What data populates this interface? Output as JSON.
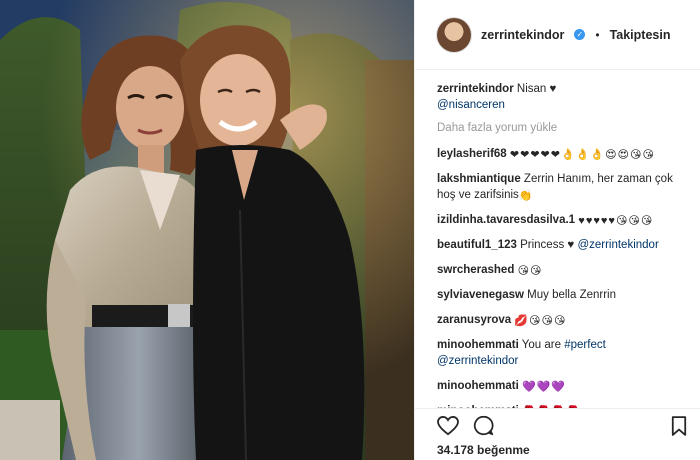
{
  "header": {
    "username": "zerrintekindor",
    "separator": "•",
    "follow_label": "Takiptesin"
  },
  "caption": {
    "user": "zerrintekindor",
    "text": "Nisan ♥",
    "mention": "@nisanceren"
  },
  "load_more": "Daha fazla yorum yükle",
  "comments": [
    {
      "user": "leylasherif68",
      "text": "",
      "emoji": "❤❤❤❤❤👌👌👌😍😍😘😘"
    },
    {
      "user": "lakshmiantique",
      "text": "Zerrin Hanım, her zaman çok hoş ve zarifsinis",
      "emoji": "👏"
    },
    {
      "user": "izildinha.tavaresdasilva.1",
      "text": "",
      "emoji": "♥♥♥♥♥😘😘😘"
    },
    {
      "user": "beautiful1_123",
      "text": "Princess ♥",
      "mention": "@zerrintekindor",
      "emoji": ""
    },
    {
      "user": "swrcherashed",
      "text": "",
      "emoji": "😘😘"
    },
    {
      "user": "sylviavenegasw",
      "text": "Muy bella Zenrrin",
      "emoji": ""
    },
    {
      "user": "zaranusyrova",
      "text": "",
      "emoji": "💋😘😘😘"
    },
    {
      "user": "minoohemmati",
      "text": "You are",
      "hashtag": "#perfect",
      "mention": "@zerrintekindor",
      "emoji": ""
    },
    {
      "user": "minoohemmati",
      "text": "",
      "emoji": "💜💜💜"
    },
    {
      "user": "minoohemmati",
      "text": "",
      "emoji": "🌹🌹🌹🌹"
    }
  ],
  "likes": "34.178 beğenme",
  "icons": {
    "like": "heart-icon",
    "comment": "comment-icon",
    "save": "bookmark-icon",
    "verified": "verified-badge-icon"
  },
  "colors": {
    "accent": "#3897f0",
    "mention": "#003569",
    "muted": "#999999",
    "heart": "#ed4956"
  }
}
